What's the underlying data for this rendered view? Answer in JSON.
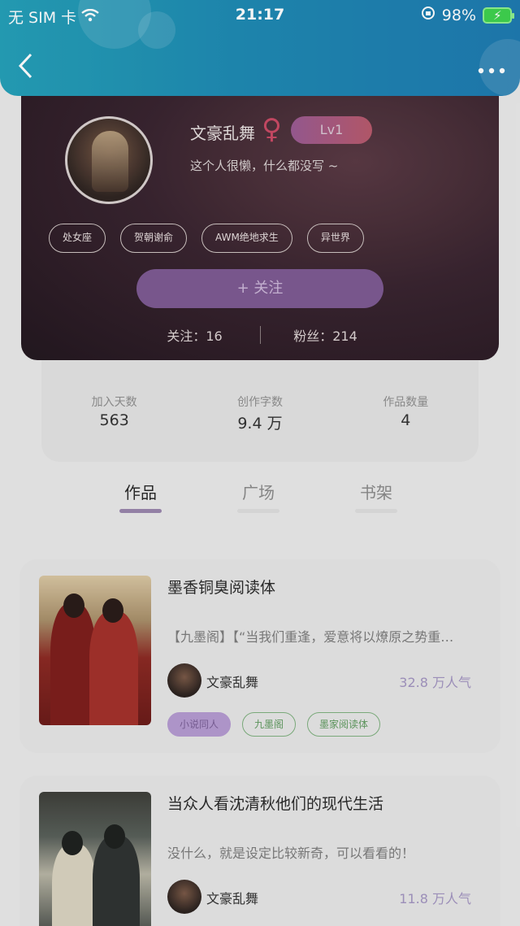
{
  "status": {
    "carrier": "无 SIM 卡",
    "time": "21:17",
    "battery": "98%"
  },
  "nav": {
    "back_icon": "chevron-left-icon",
    "more_icon": "more-dots-icon"
  },
  "profile": {
    "username": "文豪乱舞",
    "gender_symbol": "♀",
    "level": "Lv1",
    "bio": "这个人很懒，什么都没写 ~",
    "tags": [
      "处女座",
      "贺朝谢俞",
      "AWM绝地求生",
      "异世界"
    ],
    "follow_label": "+   关注",
    "following": "关注：16",
    "followers": "粉丝：214"
  },
  "stats": [
    {
      "label": "加入天数",
      "value": "563"
    },
    {
      "label": "创作字数",
      "value": "9.4 万"
    },
    {
      "label": "作品数量",
      "value": "4"
    }
  ],
  "tabs": [
    "作品",
    "广场",
    "书架"
  ],
  "active_tab": "作品",
  "works": [
    {
      "title": "墨香铜臭阅读体",
      "desc": "【九墨阁】【“当我们重逢，爱意将以燎原之势重…",
      "author": "文豪乱舞",
      "popularity": "32.8 万人气",
      "tags": [
        "小说同人",
        "九墨阁",
        "墨家阅读体"
      ]
    },
    {
      "title": "当众人看沈清秋他们的现代生活",
      "desc": "没什么，就是设定比较新奇，可以看看的！",
      "author": "文豪乱舞",
      "popularity": "11.8 万人气",
      "tags": []
    }
  ],
  "colors": {
    "header": "#1f8ab2",
    "accent": "#9a86ac",
    "follow_button": "#7d5a92"
  }
}
